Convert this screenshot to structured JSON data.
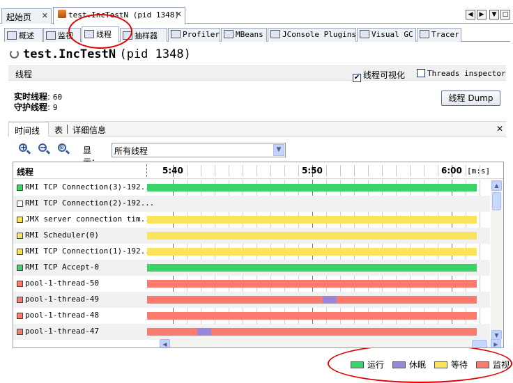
{
  "colors": {
    "running": "#3ad36a",
    "sleeping": "#9a86d8",
    "waiting": "#fbe35b",
    "monitor": "#fa7a6e",
    "highlight": "#e00000"
  },
  "doc_tabs": [
    {
      "label": "起始页",
      "icon": null,
      "active": false
    },
    {
      "label": "test.IncTestN (pid 1348)",
      "icon": "java-icon",
      "active": true
    }
  ],
  "sub_tabs": [
    {
      "label": "概述",
      "icon": "overview-icon"
    },
    {
      "label": "监视",
      "icon": "monitor-icon"
    },
    {
      "label": "线程",
      "icon": "threads-icon",
      "active": true
    },
    {
      "label": "抽样器",
      "icon": "sampler-icon"
    },
    {
      "label": "Profiler",
      "icon": "profiler-icon"
    },
    {
      "label": "MBeans",
      "icon": "mbeans-icon"
    },
    {
      "label": "JConsole Plugins",
      "icon": "jconsole-icon"
    },
    {
      "label": "Visual GC",
      "icon": "visualgc-icon"
    },
    {
      "label": "Tracer",
      "icon": "tracer-icon"
    }
  ],
  "page_title": "test.IncTestN",
  "page_title_pid": "(pid 1348)",
  "section": {
    "label": "线程",
    "visualize_label": "线程可视化",
    "visualize_checked": true,
    "inspector_label": "Threads inspector",
    "inspector_checked": false
  },
  "stats": {
    "live_label": "实时线程",
    "live_value": "60",
    "daemon_label": "守护线程",
    "daemon_value": "9"
  },
  "dump_button": "线程 Dump",
  "view_tabs": [
    {
      "label": "时间线",
      "active": true
    },
    {
      "label": "表"
    },
    {
      "label": "详细信息"
    }
  ],
  "toolbar": {
    "show_label": "显示：",
    "show_value": "所有线程",
    "zoom_in": "+",
    "zoom_out": "−",
    "zoom_fit": "⊙"
  },
  "timeline": {
    "column_header": "线程",
    "ticks": [
      "5:40",
      "5:50",
      "6:00"
    ],
    "units": "[m:s]",
    "threads": [
      {
        "name": "RMI TCP Connection(3)-192...",
        "state": "running",
        "segments": [
          {
            "state": "running",
            "from": 0,
            "to": 1
          }
        ]
      },
      {
        "name": "RMI TCP Connection(2)-192...",
        "state": "none",
        "segments": []
      },
      {
        "name": "JMX server connection tim...",
        "state": "waiting",
        "segments": [
          {
            "state": "waiting",
            "from": 0,
            "to": 1
          }
        ]
      },
      {
        "name": "RMI Scheduler(0)",
        "state": "waiting",
        "segments": [
          {
            "state": "waiting",
            "from": 0,
            "to": 1
          }
        ]
      },
      {
        "name": "RMI TCP Connection(1)-192...",
        "state": "waiting",
        "segments": [
          {
            "state": "waiting",
            "from": 0,
            "to": 1
          }
        ]
      },
      {
        "name": "RMI TCP Accept-0",
        "state": "running",
        "segments": [
          {
            "state": "running",
            "from": 0,
            "to": 1
          }
        ]
      },
      {
        "name": "pool-1-thread-50",
        "state": "monitor",
        "segments": [
          {
            "state": "monitor",
            "from": 0,
            "to": 1
          }
        ]
      },
      {
        "name": "pool-1-thread-49",
        "state": "monitor",
        "segments": [
          {
            "state": "monitor",
            "from": 0,
            "to": 0.532
          },
          {
            "state": "sleeping",
            "from": 0.532,
            "to": 0.575
          },
          {
            "state": "monitor",
            "from": 0.575,
            "to": 1
          }
        ]
      },
      {
        "name": "pool-1-thread-48",
        "state": "monitor",
        "segments": [
          {
            "state": "monitor",
            "from": 0,
            "to": 1
          }
        ]
      },
      {
        "name": "pool-1-thread-47",
        "state": "monitor",
        "segments": [
          {
            "state": "monitor",
            "from": 0,
            "to": 0.152
          },
          {
            "state": "sleeping",
            "from": 0.152,
            "to": 0.194
          },
          {
            "state": "monitor",
            "from": 0.194,
            "to": 1
          }
        ]
      }
    ]
  },
  "legend": [
    {
      "label": "运行",
      "state": "running"
    },
    {
      "label": "休眠",
      "state": "sleeping"
    },
    {
      "label": "等待",
      "state": "waiting"
    },
    {
      "label": "监视",
      "state": "monitor"
    }
  ]
}
